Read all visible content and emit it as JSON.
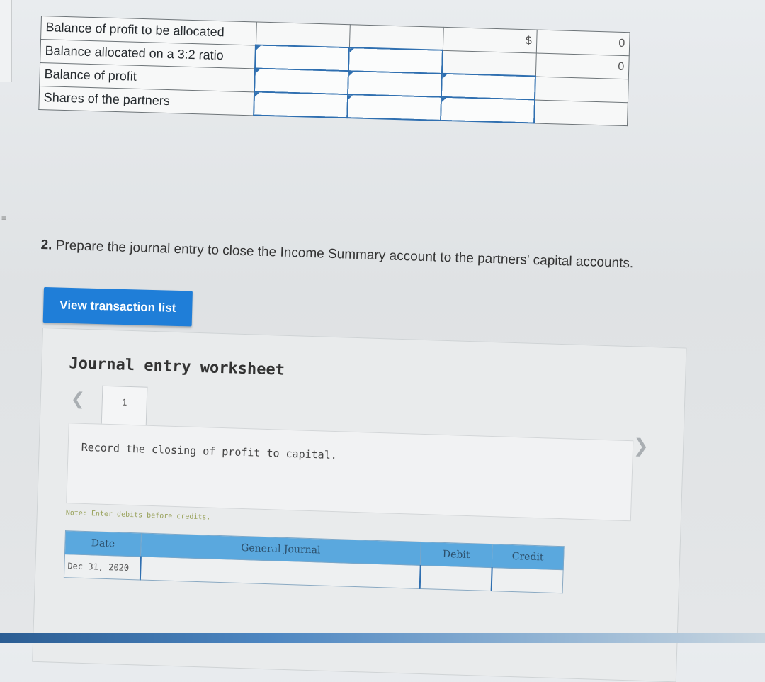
{
  "allocation_table": {
    "rows": [
      {
        "label": "Balance of profit to be allocated",
        "cells": [
          "",
          "",
          "$",
          "0"
        ]
      },
      {
        "label": "Balance allocated on a 3:2 ratio",
        "cells": [
          "",
          "",
          "",
          "0"
        ]
      },
      {
        "label": "Balance of profit",
        "cells": [
          "",
          "",
          "",
          ""
        ]
      },
      {
        "label": "Shares of the partners",
        "cells": [
          "",
          "",
          "",
          ""
        ]
      }
    ]
  },
  "question": {
    "number": "2.",
    "text": "Prepare the journal entry to close the Income Summary account to the partners' capital accounts."
  },
  "view_button": {
    "label": "View transaction list"
  },
  "worksheet": {
    "title": "Journal entry worksheet",
    "current_tab": "1",
    "instruction": "Record the closing of profit to capital.",
    "note": "Note: Enter debits before credits.",
    "table": {
      "headers": {
        "date": "Date",
        "journal": "General Journal",
        "debit": "Debit",
        "credit": "Credit"
      },
      "rows": [
        {
          "date": "Dec 31, 2020",
          "account": "",
          "debit": "",
          "credit": ""
        }
      ]
    }
  },
  "icons": {
    "prev": "chevron-left-icon",
    "next": "chevron-right-icon"
  }
}
